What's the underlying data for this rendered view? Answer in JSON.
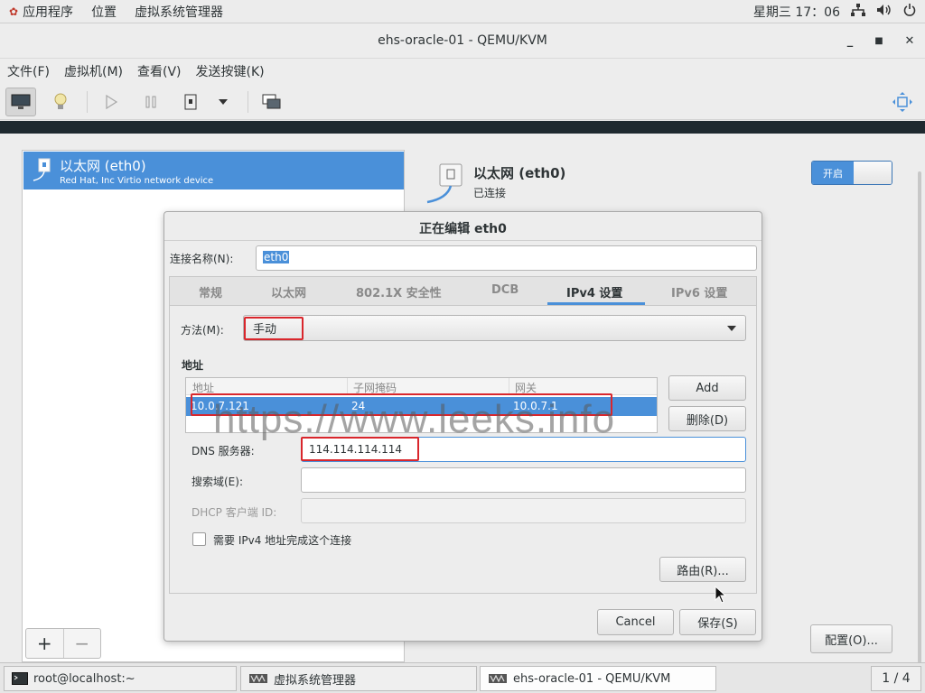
{
  "topbar": {
    "apps": "应用程序",
    "places": "位置",
    "vmm": "虚拟系统管理器",
    "clock": "星期三 17：06"
  },
  "window": {
    "title": "ehs-oracle-01 - QEMU/KVM"
  },
  "menu": {
    "file": "文件(F)",
    "vm": "虚拟机(M)",
    "view": "查看(V)",
    "sendkey": "发送按键(K)"
  },
  "nic_list": {
    "name": "以太网 (eth0)",
    "desc": "Red Hat, Inc Virtio network device"
  },
  "nic_detail": {
    "name": "以太网 (eth0)",
    "status": "已连接",
    "toggle_on": "开启",
    "config_button": "配置(O)..."
  },
  "bottom_buttons": {
    "add": "+",
    "remove": "−"
  },
  "dialog": {
    "title": "正在编辑 eth0",
    "conn_name_label": "连接名称(N):",
    "conn_name_value": "eth0",
    "tabs": [
      "常规",
      "以太网",
      "802.1X 安全性",
      "DCB",
      "IPv4 设置",
      "IPv6 设置"
    ],
    "method_label": "方法(M):",
    "method_value": "手动",
    "address_heading": "地址",
    "columns": [
      "地址",
      "子网掩码",
      "网关"
    ],
    "row": {
      "address": "10.0.7.121",
      "netmask": "24",
      "gateway": "10.0.7.1"
    },
    "add_button": "Add",
    "delete_button": "删除(D)",
    "dns_label": "DNS 服务器:",
    "dns_value": "114.114.114.114",
    "search_label": "搜索域(E):",
    "dhcp_label": "DHCP 客户端 ID:",
    "require_label": "需要 IPv4 地址完成这个连接",
    "routes_button": "路由(R)...",
    "cancel": "Cancel",
    "save": "保存(S)"
  },
  "watermark": "https://www.leeks.info",
  "taskbar": {
    "terminal": "root@localhost:~",
    "vmm": "虚拟系统管理器",
    "vm": "ehs-oracle-01 - QEMU/KVM",
    "workspace": "1 / 4"
  },
  "colors": {
    "selection": "#4a90d9",
    "highlight_red": "#d9262c"
  }
}
